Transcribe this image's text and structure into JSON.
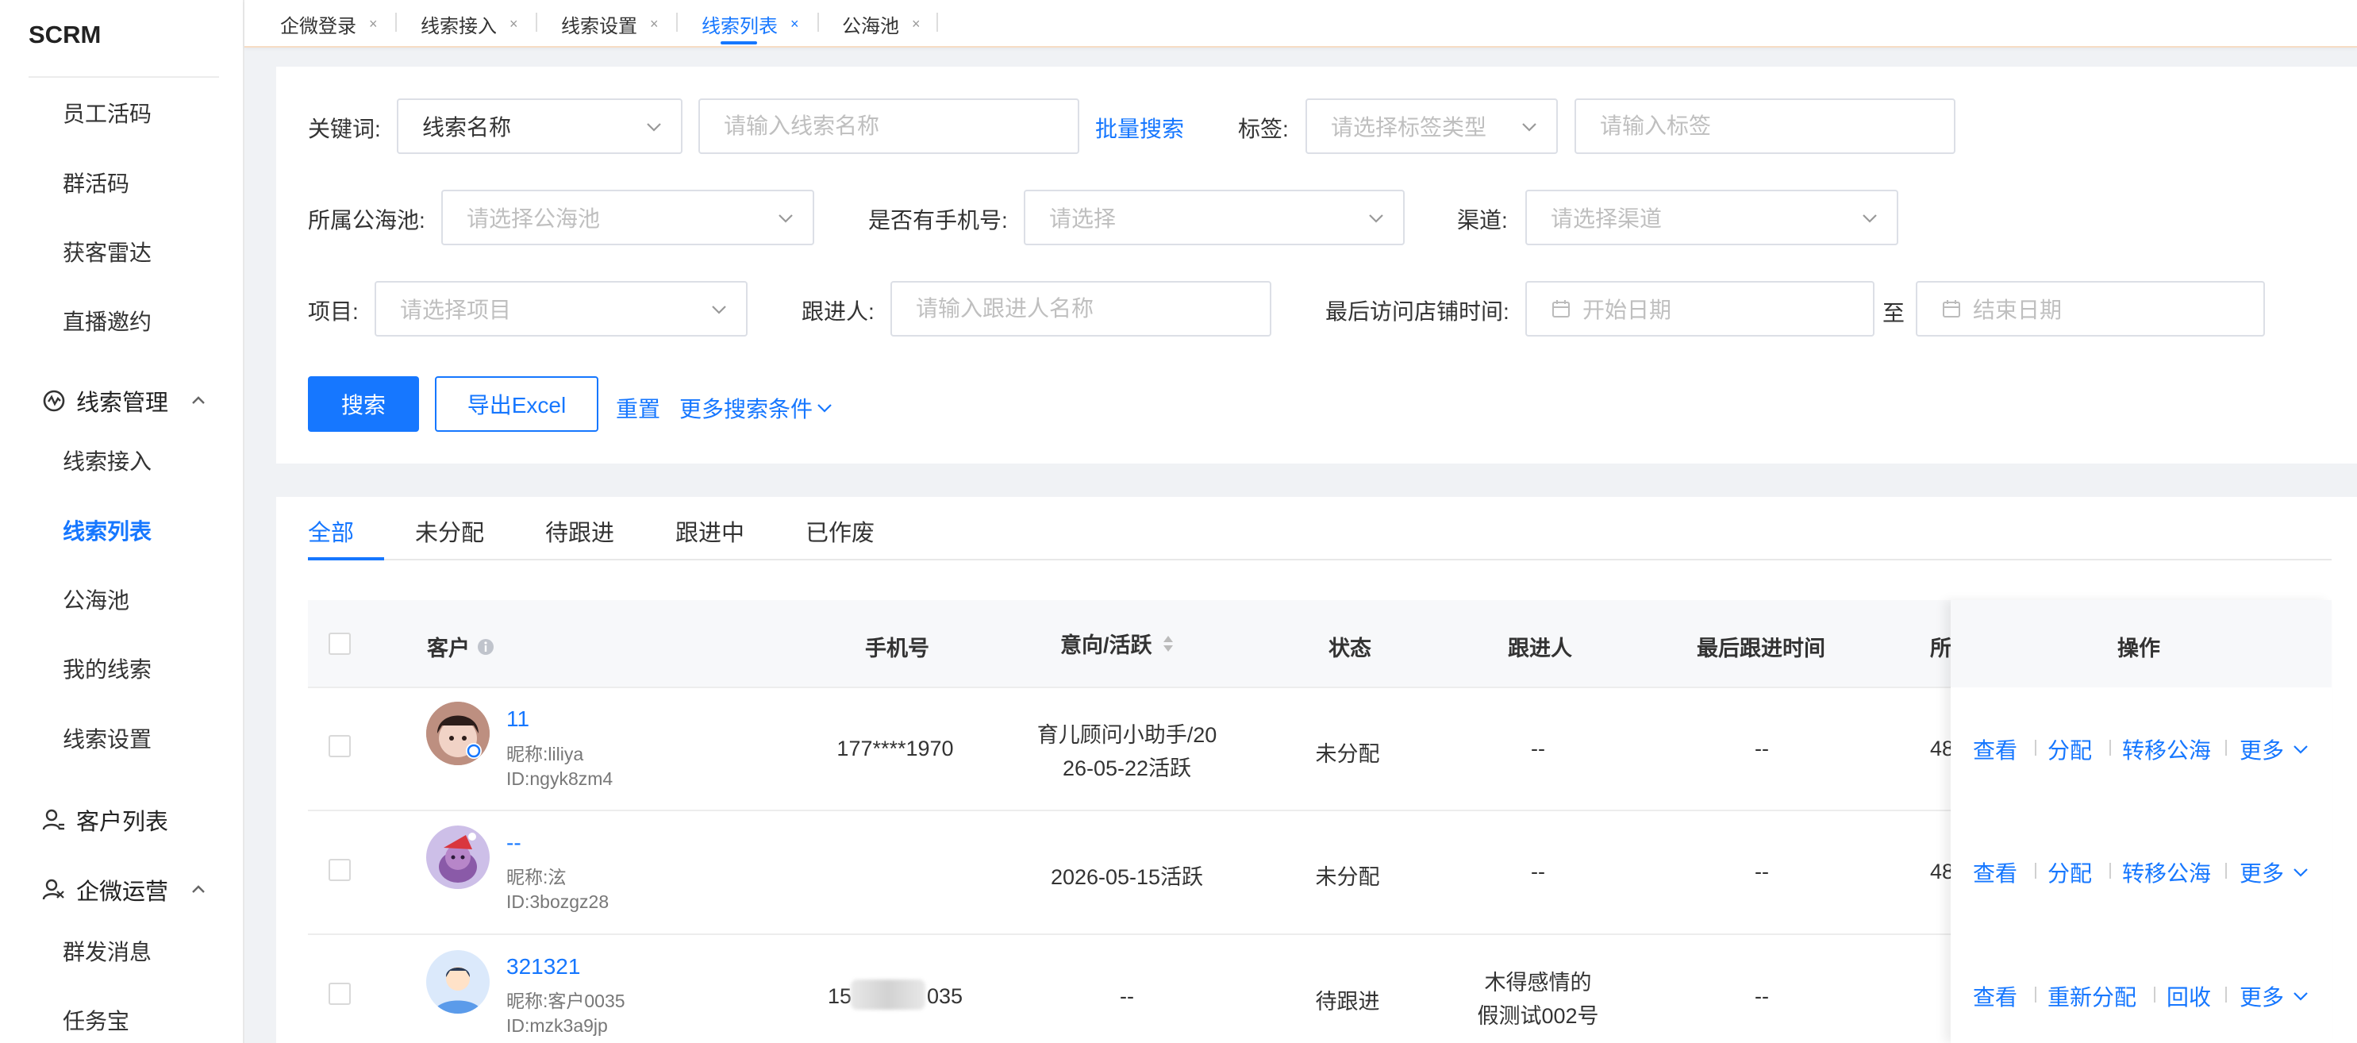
{
  "app": {
    "brand": "SCRM"
  },
  "sidebar": {
    "items_top": [
      "员工活码",
      "群活码",
      "获客雷达",
      "直播邀约"
    ],
    "group_leads": {
      "label": "线索管理",
      "icon": "leads-icon"
    },
    "leads_items": [
      "线索接入",
      "线索列表",
      "公海池",
      "我的线索",
      "线索设置"
    ],
    "active_item": "线索列表",
    "customer_list": {
      "label": "客户列表",
      "icon": "user-icon"
    },
    "group_wecom": {
      "label": "企微运营",
      "icon": "wecom-ops-icon"
    },
    "wecom_items": [
      "群发消息",
      "任务宝"
    ]
  },
  "page_tabs": [
    {
      "label": "企微登录",
      "close": "×"
    },
    {
      "label": "线索接入",
      "close": "×"
    },
    {
      "label": "线索设置",
      "close": "×"
    },
    {
      "label": "线索列表",
      "close": "×",
      "active": true
    },
    {
      "label": "公海池",
      "close": "×"
    }
  ],
  "filters": {
    "keyword_label": "关键词:",
    "keyword_type_value": "线索名称",
    "keyword_placeholder": "请输入线索名称",
    "batch_search": "批量搜索",
    "tag_label": "标签:",
    "tag_type_placeholder": "请选择标签类型",
    "tag_placeholder": "请输入标签",
    "pool_label": "所属公海池:",
    "pool_placeholder": "请选择公海池",
    "phone_label": "是否有手机号:",
    "phone_placeholder": "请选择",
    "channel_label": "渠道:",
    "channel_placeholder": "请选择渠道",
    "project_label": "项目:",
    "project_placeholder": "请选择项目",
    "follower_label": "跟进人:",
    "follower_placeholder": "请输入跟进人名称",
    "last_visit_label": "最后访问店铺时间:",
    "start_placeholder": "开始日期",
    "to_label": "至",
    "end_placeholder": "结束日期"
  },
  "actions": {
    "search": "搜索",
    "export": "导出Excel",
    "reset": "重置",
    "more_conditions": "更多搜索条件"
  },
  "list_tabs": [
    "全部",
    "未分配",
    "待跟进",
    "跟进中",
    "已作废"
  ],
  "active_list_tab": "全部",
  "table": {
    "columns": {
      "customer": "客户",
      "phone": "手机号",
      "intent": "意向/活跃",
      "status": "状态",
      "follower": "跟进人",
      "last_follow": "最后跟进时间",
      "pool_partial": "所",
      "ops": "操作"
    },
    "rows": [
      {
        "name": "11",
        "nickname": "昵称:liliya",
        "id": "ID:ngyk8zm4",
        "phone": "177****1970",
        "intent_line1": "育儿顾问小助手/20",
        "intent_line2": "26-05-22活跃",
        "status": "未分配",
        "follower_line1": "--",
        "follower_line2": "",
        "last_follow": "--",
        "pool_partial": "48",
        "ops": [
          "查看",
          "分配",
          "转移公海",
          "更多"
        ]
      },
      {
        "name": "--",
        "nickname": "昵称:泫",
        "id": "ID:3bozgz28",
        "phone": "",
        "intent_line1": "2026-05-15活跃",
        "intent_line2": "",
        "status": "未分配",
        "follower_line1": "--",
        "follower_line2": "",
        "last_follow": "--",
        "pool_partial": "48",
        "ops": [
          "查看",
          "分配",
          "转移公海",
          "更多"
        ]
      },
      {
        "name": "321321",
        "nickname": "昵称:客户0035",
        "id": "ID:mzk3a9jp",
        "phone_prefix": "15",
        "phone_suffix": "035",
        "intent_line1": "--",
        "intent_line2": "",
        "status": "待跟进",
        "follower_line1": "木得感情的",
        "follower_line2": "假测试002号",
        "last_follow": "--",
        "pool_partial": "",
        "ops": [
          "查看",
          "重新分配",
          "回收",
          "更多"
        ]
      }
    ]
  },
  "colors": {
    "accent": "#1677ff",
    "page_bg": "#f0f2f5",
    "header_bg": "#f7f8fa"
  }
}
